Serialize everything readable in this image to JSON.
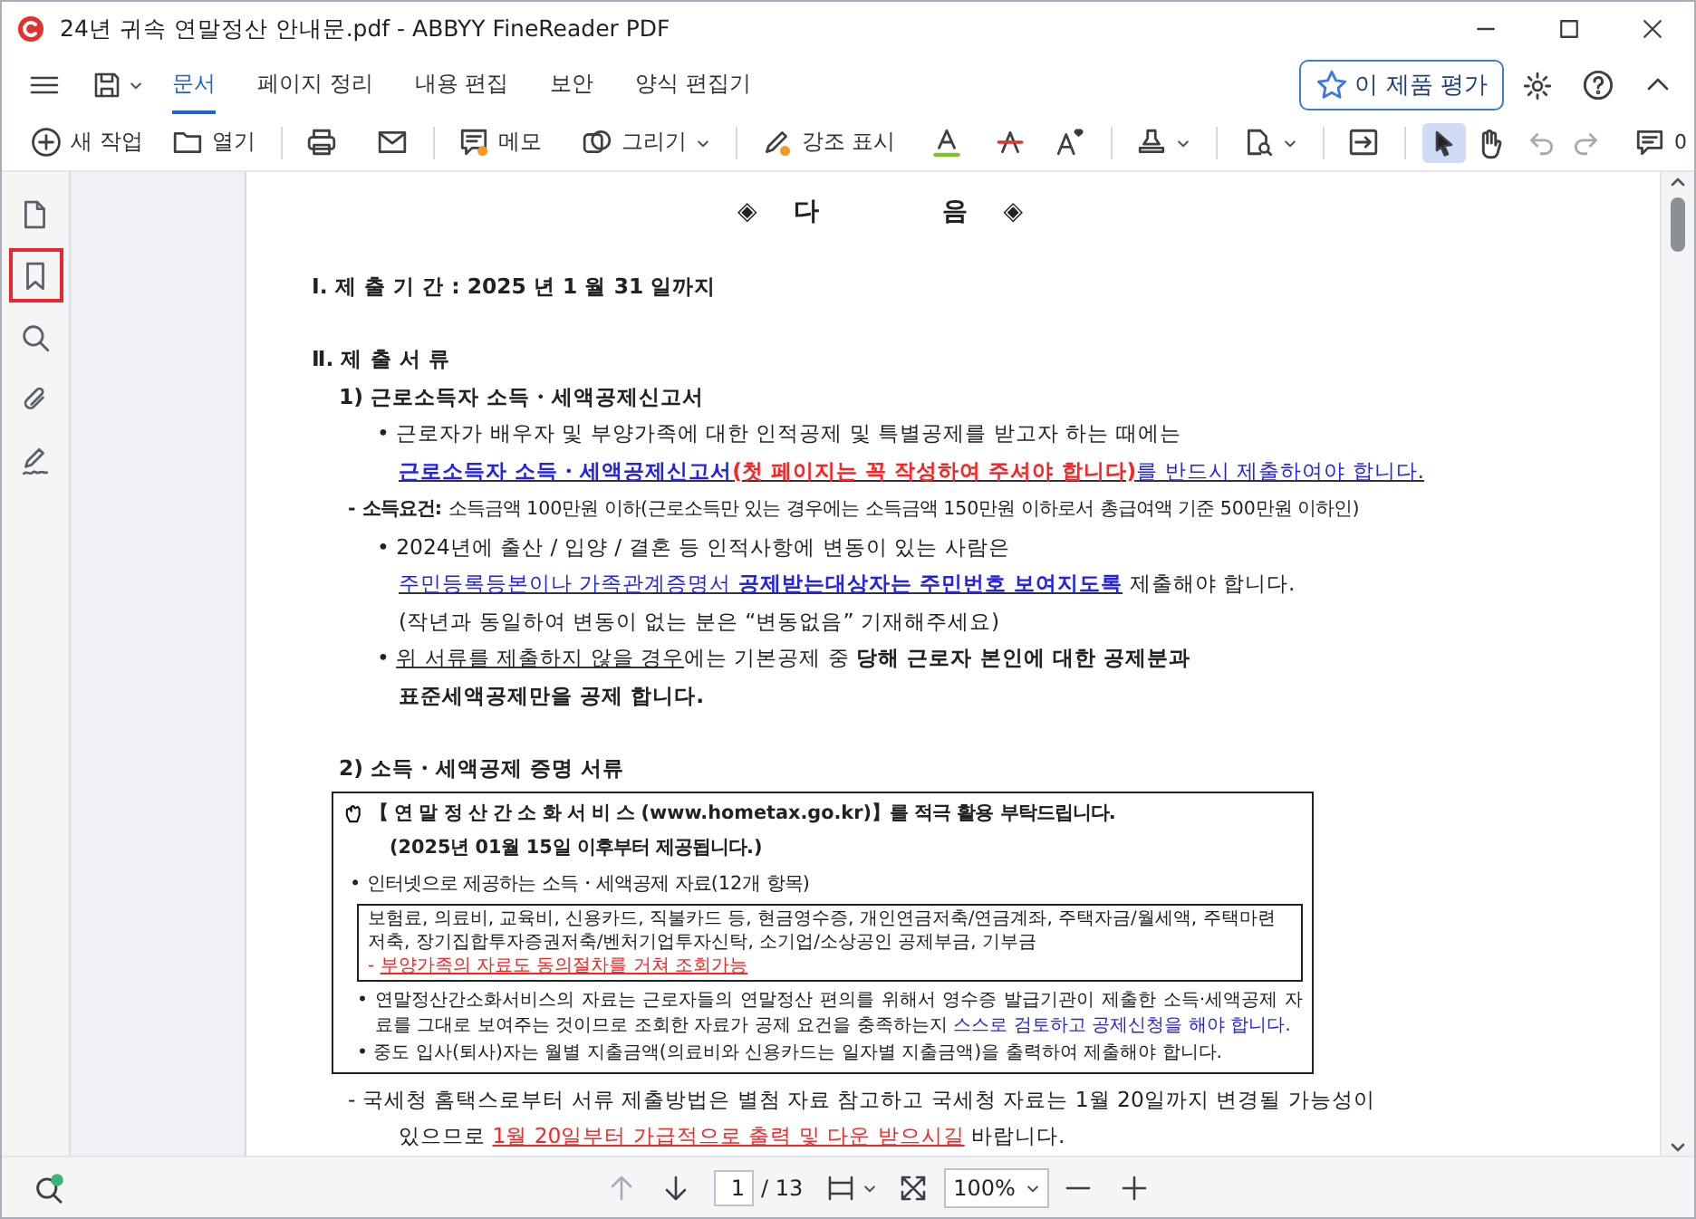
{
  "window": {
    "title": "24년 귀속 연말정산 안내문.pdf - ABBYY FineReader PDF"
  },
  "menu_tabs": [
    {
      "label": "문서",
      "selected": true
    },
    {
      "label": "페이지 정리",
      "selected": false
    },
    {
      "label": "내용 편집",
      "selected": false
    },
    {
      "label": "보안",
      "selected": false
    },
    {
      "label": "양식 편집기",
      "selected": false
    }
  ],
  "rate_button": "이 제품 평가",
  "toolbar": {
    "new_task": "새 작업",
    "open": "열기",
    "memo": "메모",
    "draw": "그리기",
    "highlight": "강조 표시",
    "comment_count": "0"
  },
  "pointer_tools": [
    {
      "selected": true
    },
    {
      "selected": false
    }
  ],
  "history_buttons": [
    {
      "disabled": true
    },
    {
      "disabled": true
    }
  ],
  "sidebar_items": [
    {
      "selected": false
    },
    {
      "selected": true
    },
    {
      "selected": false
    },
    {
      "selected": false
    },
    {
      "selected": false
    }
  ],
  "document": {
    "heading": [
      "◈",
      "다",
      "음",
      "◈"
    ],
    "lines": [
      {
        "kind": "section",
        "segments": [
          {
            "kind": "bold",
            "text": "Ⅰ. 제 출 기 간  :  2025 년    1 월    31 일까지"
          }
        ]
      },
      {
        "kind": "section",
        "segments": [
          {
            "kind": "bold",
            "text": "Ⅱ. 제 출 서 류"
          }
        ]
      },
      {
        "kind": "sub",
        "segments": [
          {
            "kind": "bold",
            "text": "1)   근로소득자 소득・세액공제신고서"
          }
        ]
      },
      {
        "kind": "bullet",
        "segments": [
          {
            "kind": "plain",
            "text": "• 근로자가 배우자 및 부양가족에 대한 인적공제 및 특별공제를 받고자 하는 때에는"
          }
        ]
      },
      {
        "kind": "cont",
        "segments": [
          {
            "kind": "emphasis",
            "text": "근로소득자 소득・세액공제신고서"
          },
          {
            "kind": "warning",
            "text": "(첫 페이지는 꼭 작성하여 주셔야 합니다)"
          },
          {
            "kind": "link",
            "text": "를 반드시 제출하여야 합니다."
          }
        ]
      },
      {
        "kind": "dash",
        "segments": [
          {
            "kind": "label",
            "text": "- 소득요건:"
          },
          {
            "kind": "small",
            "text": " 소득금액 100만원 이하(근로소득만 있는 경우에는 소득금액 150만원 이하로서 총급여액 기준 500만원 이하인)"
          }
        ]
      },
      {
        "kind": "bullet",
        "segments": [
          {
            "kind": "plain",
            "text": "• 2024년에 출산 / 입양 / 결혼 등 인적사항에 변동이 있는 사람은"
          }
        ]
      },
      {
        "kind": "cont",
        "segments": [
          {
            "kind": "link",
            "text": "주민등록등본이나 가족관계증명서 "
          },
          {
            "kind": "emphasis",
            "text": "공제받는대상자는 주민번호 보여지도록"
          },
          {
            "kind": "plain",
            "text": " 제출해야 합니다."
          }
        ]
      },
      {
        "kind": "cont",
        "segments": [
          {
            "kind": "plain",
            "text": "(작년과 동일하여 변동이 없는 분은 “변동없음” 기재해주세요)"
          }
        ]
      },
      {
        "kind": "bullet",
        "segments": [
          {
            "kind": "plain",
            "text": "• "
          },
          {
            "kind": "underlined",
            "text": "위 서류를 제출하지 않을 경우"
          },
          {
            "kind": "plain",
            "text": "에는 기본공제 중 "
          },
          {
            "kind": "bold",
            "text": "당해 근로자 본인에 대한 공제분과"
          }
        ]
      },
      {
        "kind": "cont",
        "segments": [
          {
            "kind": "bold",
            "text": "표준세액공제만을 공제 합니다."
          }
        ]
      },
      {
        "kind": "subsection",
        "segments": [
          {
            "kind": "bold",
            "text": "2) 소득・세액공제 증명 서류"
          }
        ]
      }
    ],
    "notice_box": {
      "lines": [
        {
          "kind": "title",
          "segments": [
            {
              "kind": "bold",
              "text": "【 연 말 정 산 간 소 화 서 비 스  (www.hometax.go.kr)】를  적극 활용 부탁드립니다."
            }
          ]
        },
        {
          "kind": "indent",
          "segments": [
            {
              "kind": "bold",
              "text": "(2025년 01월 15일 이후부터 제공됩니다.)"
            }
          ]
        },
        {
          "kind": "bullet",
          "segments": [
            {
              "kind": "plain",
              "text": "• 인터넷으로 제공하는 소득・세액공제 자료(12개 항목)"
            }
          ]
        },
        {
          "kind": "inner_box",
          "lines": [
            [
              {
                "kind": "plain",
                "text": "보험료, 의료비, 교육비, 신용카드, 직불카드 등, 현금영수증, 개인연금저축/연금계좌, 주택자금/월세액, 주택마련저축, 장기집합투자증권저축/벤처기업투자신탁, 소기업/소상공인 공제부금, 기부금"
              }
            ],
            [
              {
                "kind": "alert-mark",
                "text": "- "
              },
              {
                "kind": "alert",
                "text": "부양가족의 자료도 동의절차를 거쳐 조회가능"
              }
            ]
          ]
        },
        {
          "kind": "wrap_bullet",
          "segments": [
            {
              "kind": "plain",
              "text": "• 연말정산간소화서비스의 자료는 근로자들의 연말정산 편의를 위해서 영수증 발급기관이 제출한 소득·세액공제 자료를 그대로 보여주는 것이므로 조회한 자료가 공제 요건을 충족하는지 "
            },
            {
              "kind": "highlight",
              "text": "스스로 검토하고 공제신청을 해야 합니다."
            }
          ]
        },
        {
          "kind": "wrap_bullet",
          "segments": [
            {
              "kind": "plain",
              "text": "• 중도 입사(퇴사)자는 월별 지출금액(의료비와 신용카드는 일자별 지출금액)을 출력하여 제출해야 합니다."
            }
          ]
        }
      ]
    },
    "after_lines": [
      {
        "kind": "dash",
        "segments": [
          {
            "kind": "plain",
            "text": "- 국세청 홈택스로부터 서류 제출방법은 별첨 자료 참고하고 국세청 자료는 1월 20일까지 변경될 가능성이"
          }
        ]
      },
      {
        "kind": "cont",
        "segments": [
          {
            "kind": "plain",
            "text": "있으므로 "
          },
          {
            "kind": "alert",
            "text": "1월 20일부터 가급적으로 출력 및 다운 받으시길"
          },
          {
            "kind": "plain",
            "text": " 바랍니다."
          }
        ]
      }
    ]
  },
  "status_bar": {
    "page": "1",
    "page_total": "/ 13",
    "zoom": "100%"
  }
}
